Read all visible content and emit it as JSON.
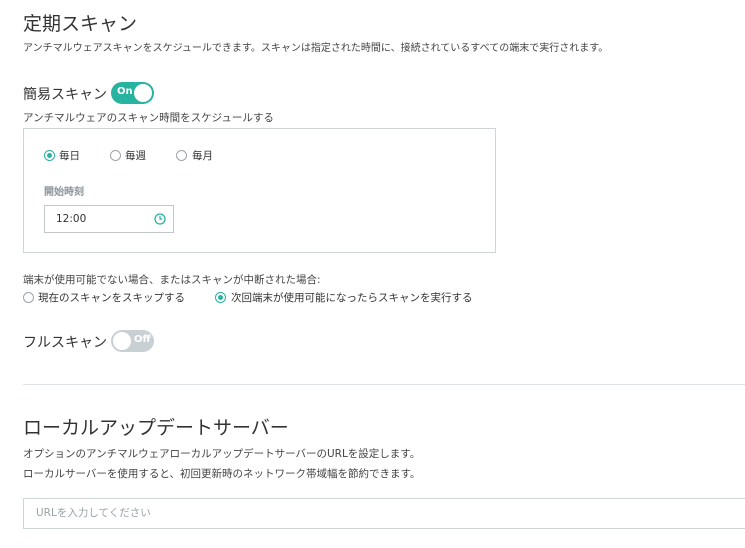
{
  "scheduled_scan": {
    "title": "定期スキャン",
    "description": "アンチマルウェアスキャンをスケジュールできます。スキャンは指定された時間に、接続されているすべての端末で実行されます。"
  },
  "quick_scan": {
    "label": "簡易スキャン",
    "toggle_label": "On",
    "enabled": true,
    "schedule_label": "アンチマルウェアのスキャン時間をスケジュールする",
    "frequency_options": [
      {
        "label": "毎日",
        "checked": true
      },
      {
        "label": "毎週",
        "checked": false
      },
      {
        "label": "毎月",
        "checked": false
      }
    ],
    "start_time_label": "開始時刻",
    "start_time_value": "12:00"
  },
  "unavailable": {
    "label": "端末が使用可能でない場合、またはスキャンが中断された場合:",
    "options": [
      {
        "label": "現在のスキャンをスキップする",
        "checked": false
      },
      {
        "label": "次回端末が使用可能になったらスキャンを実行する",
        "checked": true
      }
    ]
  },
  "full_scan": {
    "label": "フルスキャン",
    "toggle_label": "Off",
    "enabled": false
  },
  "local_update_server": {
    "title": "ローカルアップデートサーバー",
    "description_1": "オプションのアンチマルウェアローカルアップデートサーバーのURLを設定します。",
    "description_2": "ローカルサーバーを使用すると、初回更新時のネットワーク帯域幅を節約できます。",
    "url_placeholder": "URLを入力してください",
    "url_value": ""
  },
  "colors": {
    "accent": "#26b3a0",
    "toggle_off": "#c9d0d4"
  }
}
